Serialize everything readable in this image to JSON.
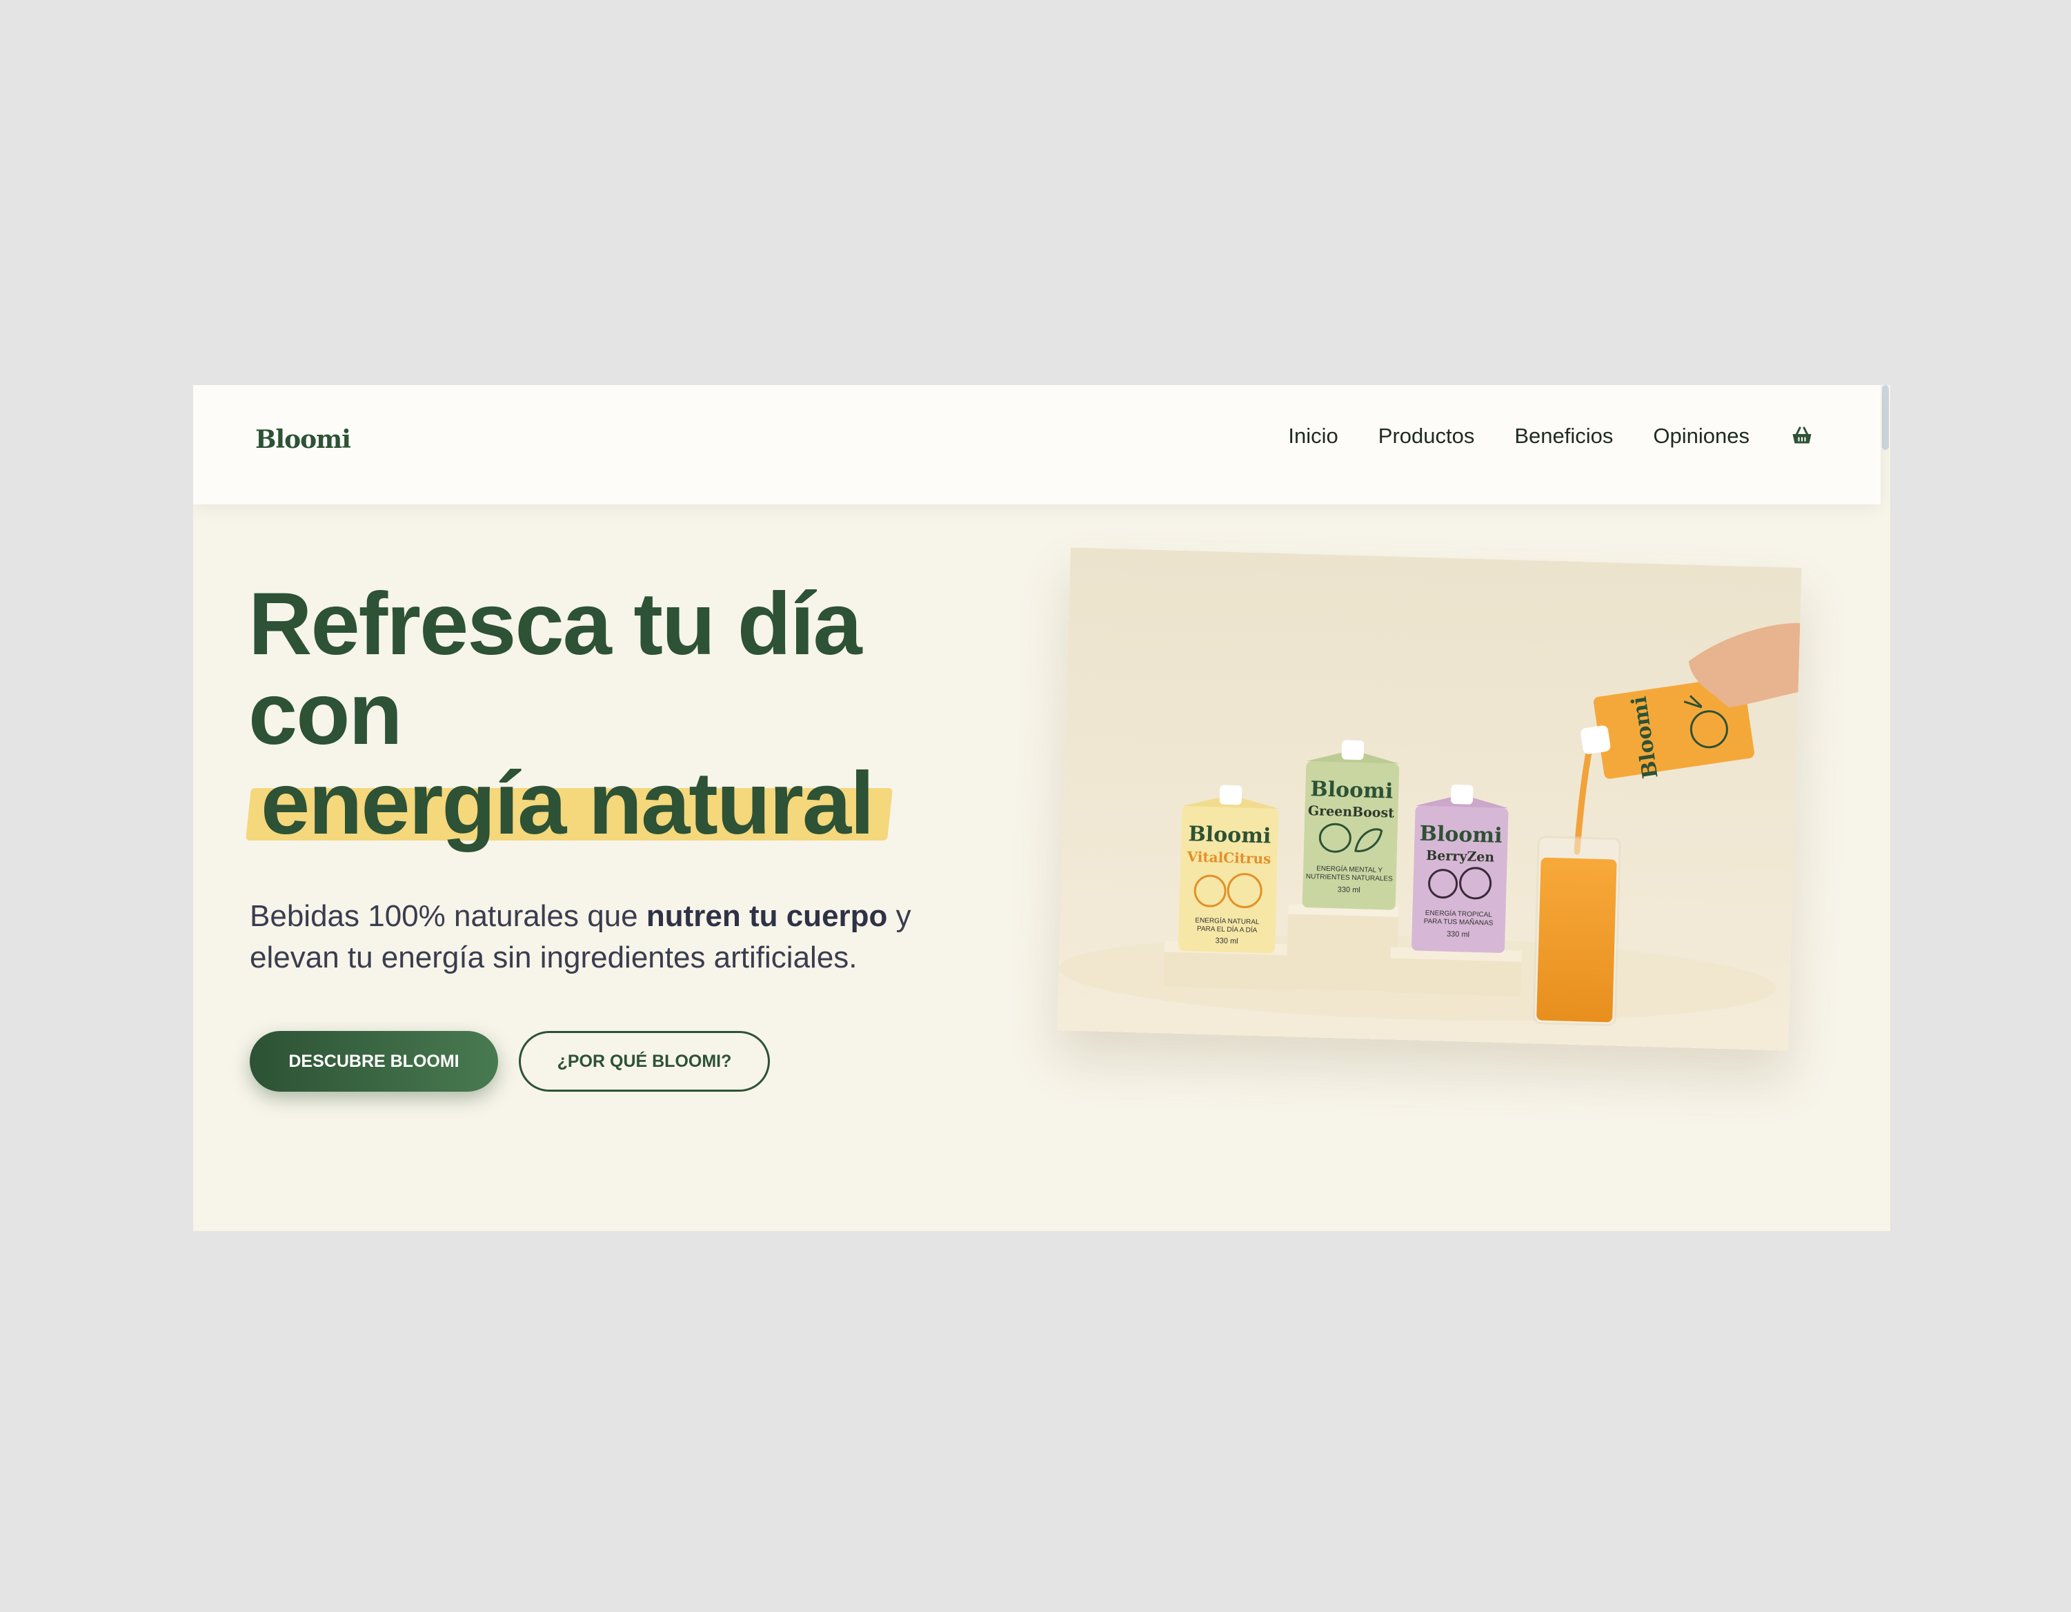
{
  "brand": {
    "logo": "Bloomi"
  },
  "nav": {
    "items": [
      {
        "label": "Inicio"
      },
      {
        "label": "Productos"
      },
      {
        "label": "Beneficios"
      },
      {
        "label": "Opiniones"
      }
    ],
    "cart_icon": "basket-icon"
  },
  "hero": {
    "title_line1": "Refresca tu día",
    "title_line2": "con",
    "title_highlight": "energía natural",
    "subtitle_part1": "Bebidas 100% naturales que ",
    "subtitle_bold": "nutren tu cuerpo",
    "subtitle_part2": " y elevan tu energía sin ingredientes artificiales.",
    "primary_button": "DESCUBRE BLOOMI",
    "secondary_button": "¿POR QUÉ BLOOMI?"
  },
  "product_photo": {
    "packs": [
      {
        "brand": "Bloomi",
        "name": "VitalCitrus",
        "tagline1": "ENERGÍA NATURAL",
        "tagline2": "PARA EL DÍA A DÍA",
        "volume": "330 ml"
      },
      {
        "brand": "Bloomi",
        "name": "GreenBoost",
        "tagline1": "ENERGÍA MENTAL Y",
        "tagline2": "NUTRIENTES NATURALES",
        "volume": "330 ml"
      },
      {
        "brand": "Bloomi",
        "name": "BerryZen",
        "tagline1": "ENERGÍA TROPICAL",
        "tagline2": "PARA TUS MAÑANAS",
        "volume": "330 ml"
      },
      {
        "brand": "Bloomi"
      }
    ]
  },
  "colors": {
    "primary_green": "#2d5235",
    "highlight_yellow": "#f5d77c",
    "hero_bg": "#f7f4e9",
    "nav_bg": "#fdfcf9"
  }
}
